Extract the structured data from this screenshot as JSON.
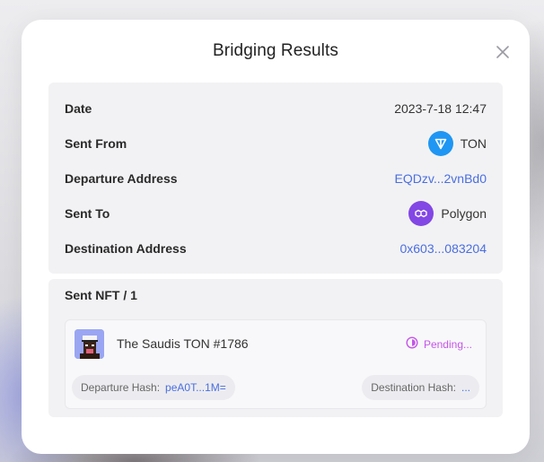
{
  "modal": {
    "title": "Bridging Results"
  },
  "summary": {
    "date": {
      "label": "Date",
      "value": "2023-7-18 12:47"
    },
    "sent_from": {
      "label": "Sent From",
      "value": "TON",
      "icon": "ton-icon"
    },
    "departure_address": {
      "label": "Departure Address",
      "value": "EQDzv...2vnBd0"
    },
    "sent_to": {
      "label": "Sent To",
      "value": "Polygon",
      "icon": "polygon-icon"
    },
    "destination_address": {
      "label": "Destination Address",
      "value": "0x603...083204"
    }
  },
  "nft_section": {
    "title": "Sent NFT / 1",
    "items": [
      {
        "name": "The Saudis TON #1786",
        "status": "Pending...",
        "departure_hash_label": "Departure Hash:",
        "departure_hash_value": "peA0T...1M=",
        "destination_hash_label": "Destination Hash:",
        "destination_hash_value": "..."
      }
    ]
  },
  "colors": {
    "link": "#4a6ee0",
    "ton_blue": "#1f96f3",
    "polygon_purple": "#8247e5",
    "pending": "#c456e8"
  }
}
